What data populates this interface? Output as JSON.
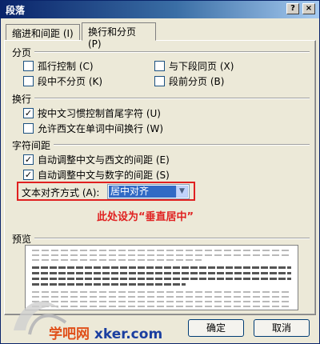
{
  "window": {
    "title": "段落",
    "help_glyph": "?",
    "close_glyph": "×"
  },
  "tabs": [
    {
      "label": "缩进和间距 (I)"
    },
    {
      "label": "换行和分页 (P)"
    }
  ],
  "pagination": {
    "title": "分页",
    "options": [
      {
        "label": "孤行控制 (C)",
        "checked": false
      },
      {
        "label": "与下段同页 (X)",
        "checked": false
      },
      {
        "label": "段中不分页 (K)",
        "checked": false
      },
      {
        "label": "段前分页 (B)",
        "checked": false
      }
    ]
  },
  "line_break": {
    "title": "换行",
    "options": [
      {
        "label": "按中文习惯控制首尾字符 (U)",
        "checked": true
      },
      {
        "label": "允许西文在单词中间换行 (W)",
        "checked": false
      }
    ]
  },
  "char_spacing": {
    "title": "字符间距",
    "options": [
      {
        "label": "自动调整中文与西文的间距 (E)",
        "checked": true
      },
      {
        "label": "自动调整中文与数字的间距 (S)",
        "checked": true
      }
    ],
    "align_label": "文本对齐方式 (A):",
    "align_value": "居中对齐"
  },
  "annotation": "此处设为“垂直居中”",
  "preview": {
    "title": "预览"
  },
  "buttons": {
    "ok": "确定",
    "cancel": "取消"
  },
  "watermark": {
    "text_a": "学吧网",
    "text_b": "xker.com"
  },
  "colors": {
    "accent_red": "#e02020",
    "title_bar": "#0a246a",
    "selection": "#316ac5"
  }
}
